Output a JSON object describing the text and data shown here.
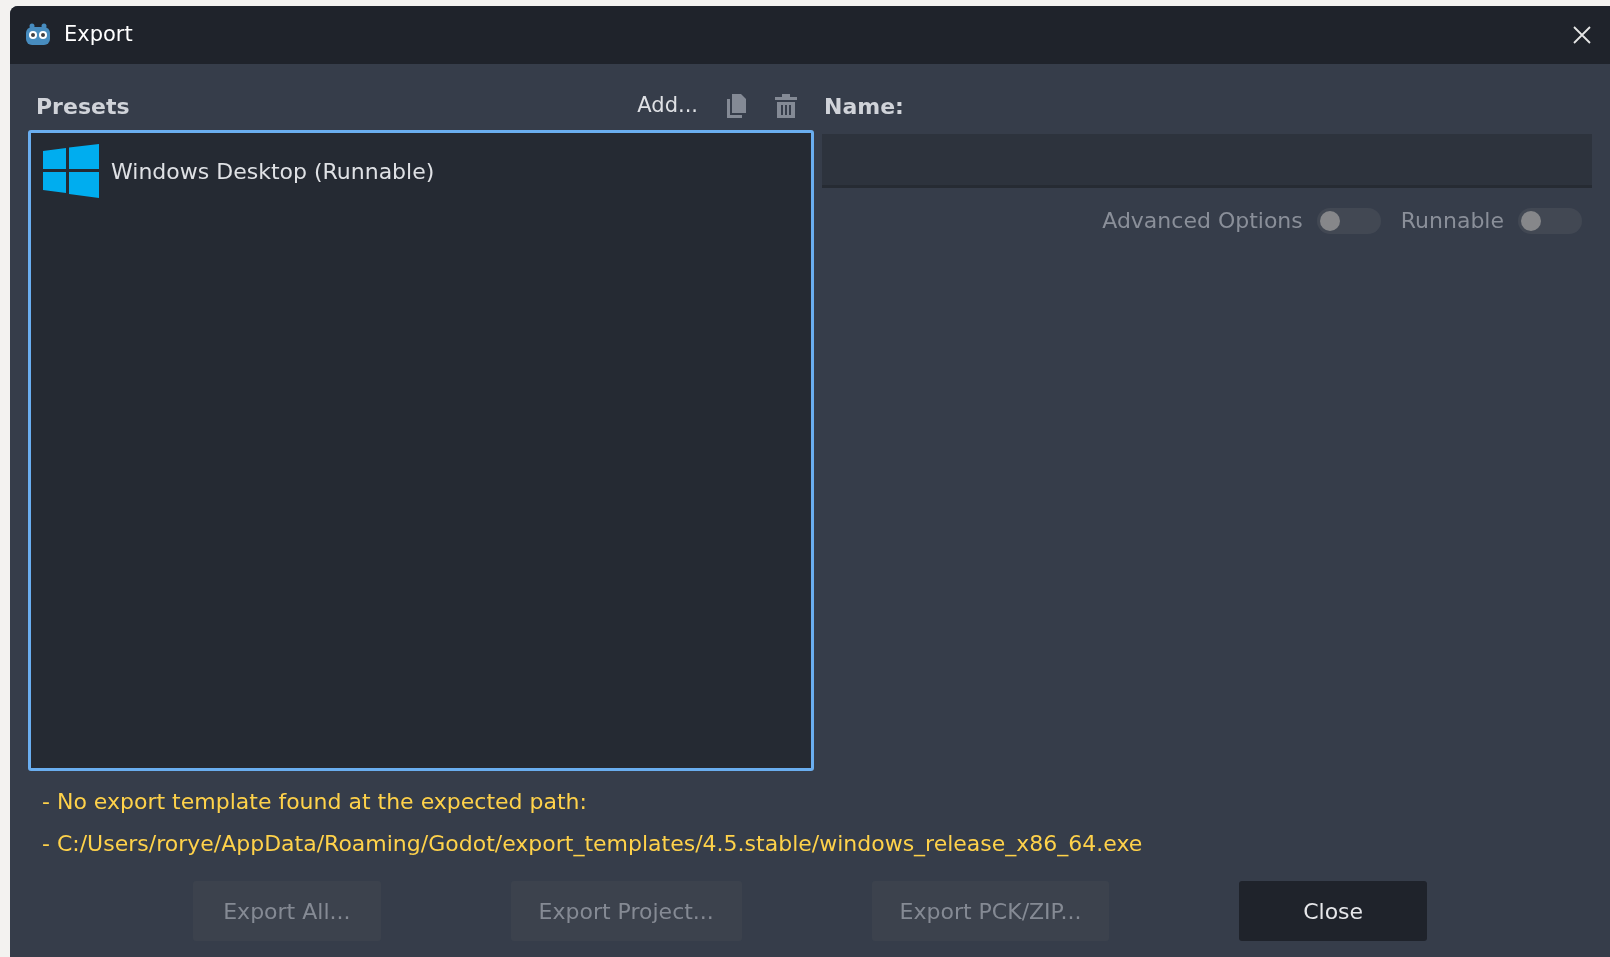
{
  "window": {
    "title": "Export"
  },
  "presets": {
    "title": "Presets",
    "add_label": "Add...",
    "items": [
      {
        "label": "Windows Desktop (Runnable)",
        "selected": false
      }
    ]
  },
  "name": {
    "label": "Name:"
  },
  "toggles": [
    {
      "label": "Advanced Options",
      "on": false,
      "disabled": true
    },
    {
      "label": "Runnable",
      "on": false,
      "disabled": true
    }
  ],
  "warnings": [
    "- No export template found at the expected path:",
    "- C:/Users/rorye/AppData/Roaming/Godot/export_templates/4.5.stable/windows_release_x86_64.exe"
  ],
  "buttons": [
    {
      "label": "Export All...",
      "disabled": true
    },
    {
      "label": "Export Project...",
      "disabled": true
    },
    {
      "label": "Export PCK/ZIP...",
      "disabled": true
    },
    {
      "label": "Close",
      "disabled": false
    }
  ]
}
